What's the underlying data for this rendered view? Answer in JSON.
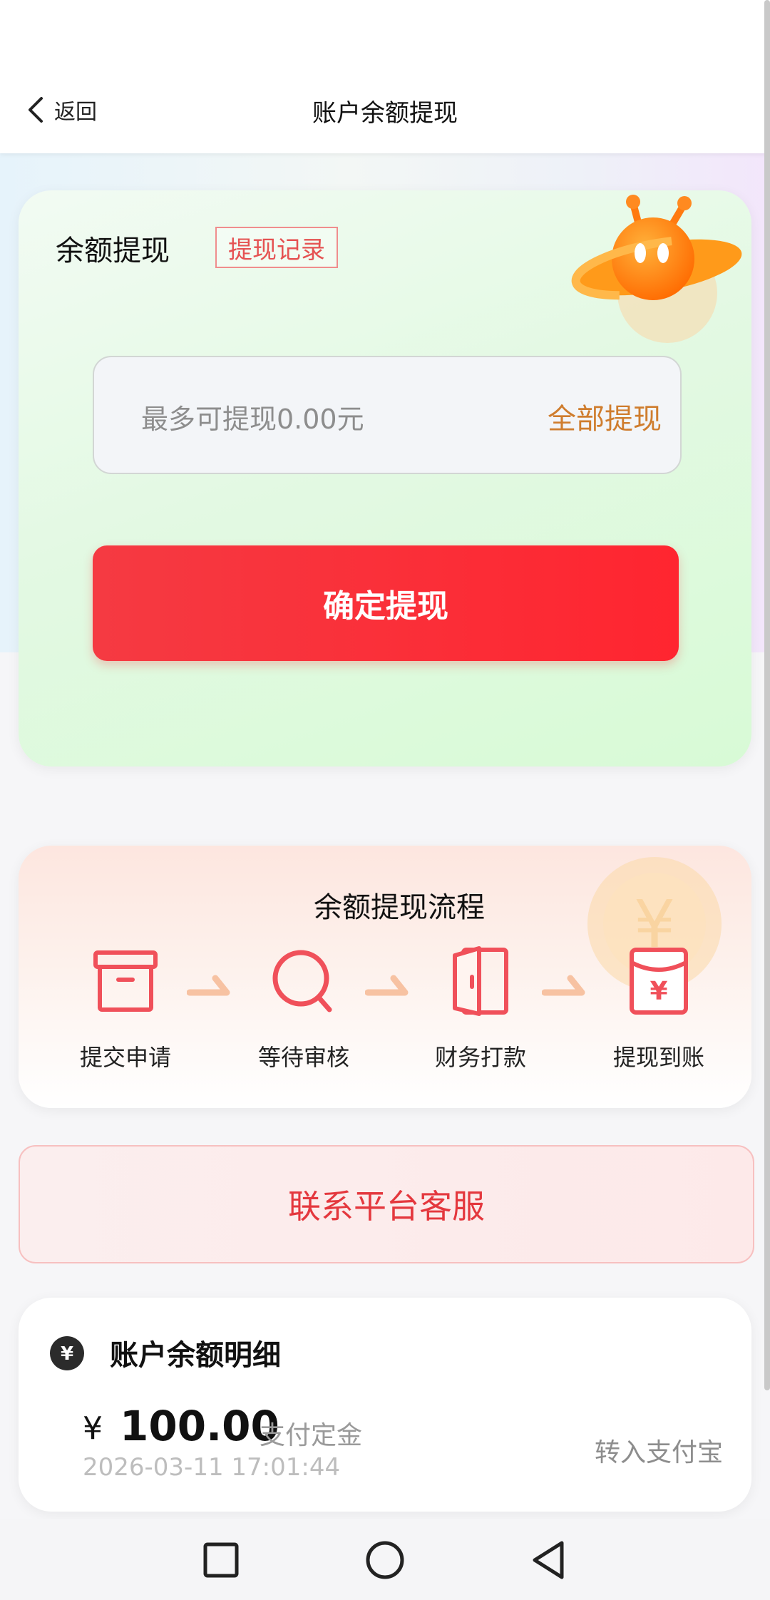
{
  "header": {
    "back_label": "返回",
    "title": "账户余额提现"
  },
  "withdraw": {
    "section_title": "余额提现",
    "records_label": "提现记录",
    "amount_placeholder": "最多可提现0.00元",
    "all_label": "全部提现",
    "confirm_label": "确定提现"
  },
  "flow": {
    "title": "余额提现流程",
    "steps": [
      {
        "label": "提交申请",
        "icon": "archive-box-icon"
      },
      {
        "label": "等待审核",
        "icon": "search-icon"
      },
      {
        "label": "财务打款",
        "icon": "door-open-icon"
      },
      {
        "label": "提现到账",
        "icon": "red-envelope-yen-icon"
      }
    ],
    "accent_color": "#f0505a"
  },
  "contact": {
    "label": "联系平台客服"
  },
  "detail": {
    "title": "账户余额明细",
    "items": [
      {
        "currency": "¥",
        "amount": "100.00",
        "note": "支付定金",
        "time": "2026-03-11 17:01:44",
        "action": "转入支付宝"
      }
    ]
  },
  "colors": {
    "primary_red": "#ff2a33",
    "link_orange": "#cf7d2e",
    "contact_red": "#e4383e"
  }
}
